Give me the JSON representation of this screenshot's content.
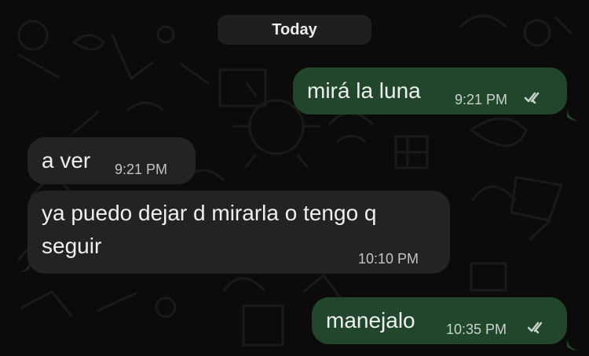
{
  "chat": {
    "date_label": "Today",
    "messages": [
      {
        "direction": "outgoing",
        "text": "mirá la luna",
        "time": "9:21 PM",
        "status": "read"
      },
      {
        "direction": "incoming",
        "text": "a ver",
        "time": "9:21 PM"
      },
      {
        "direction": "incoming",
        "text": "ya puedo dejar d mirarla o tengo q\nseguir",
        "time": "10:10 PM"
      },
      {
        "direction": "outgoing",
        "text": "manejalo",
        "time": "10:35 PM",
        "status": "read"
      }
    ]
  },
  "theme": {
    "background": "#0b0b0b",
    "outgoing_bubble": "#21462c",
    "incoming_bubble": "#232323",
    "text": "#edf0ef",
    "meta_text": "#c9d3cc"
  },
  "icons": {
    "read_receipt": "double-check-icon"
  }
}
